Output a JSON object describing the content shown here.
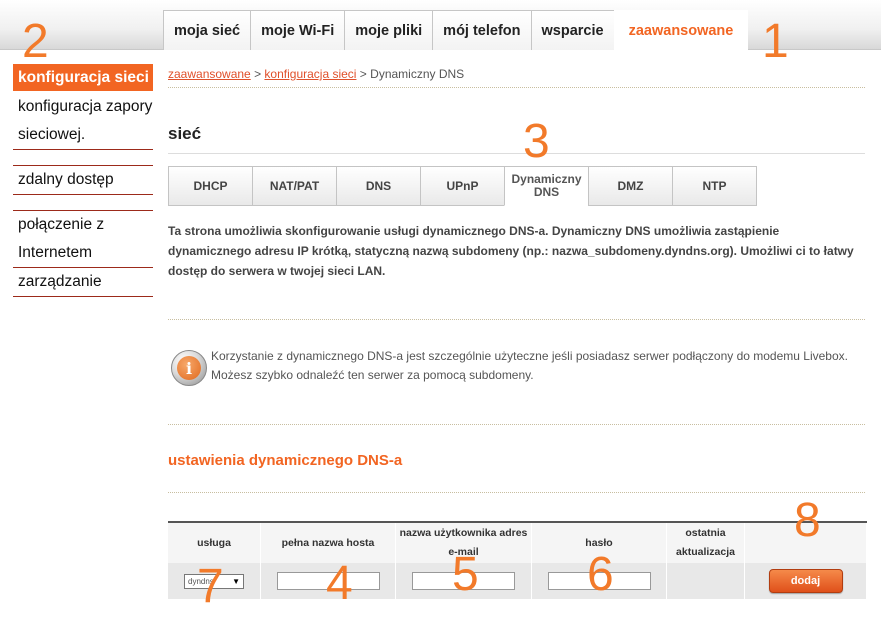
{
  "top_nav": {
    "tabs": [
      "moja sieć",
      "moje Wi-Fi",
      "moje pliki",
      "mój telefon",
      "wsparcie",
      "zaawansowane"
    ]
  },
  "sidebar": {
    "items": [
      "konfiguracja sieci",
      "konfiguracja zapory sieciowej.",
      "zdalny dostęp",
      "połączenie z Internetem",
      "zarządzanie"
    ]
  },
  "breadcrumb": {
    "link1": "zaawansowane",
    "sep1": " > ",
    "link2": "konfiguracja sieci",
    "sep2": " > ",
    "current": "Dynamiczny DNS"
  },
  "page_title": "sieć",
  "sub_tabs": [
    "DHCP",
    "NAT/PAT",
    "DNS",
    "UPnP",
    "Dynamiczny DNS",
    "DMZ",
    "NTP"
  ],
  "description": "Ta strona umożliwia skonfigurowanie usługi dynamicznego DNS-a. Dynamiczny DNS umożliwia zastąpienie dynamicznego adresu IP krótką, statyczną nazwą subdomeny (np.: nazwa_subdomeny.dyndns.org). Umożliwi ci to łatwy dostęp do serwera w twojej sieci LAN.",
  "info": {
    "icon": "info-icon",
    "text": "Korzystanie z dynamicznego DNS-a jest szczególnie użyteczne jeśli posiadasz serwer podłączony do modemu Livebox. Możesz szybko odnaleźć ten serwer za pomocą subdomeny."
  },
  "section_title": "ustawienia dynamicznego DNS-a",
  "table": {
    "headers": [
      "usługa",
      "pełna nazwa hosta",
      "nazwa użytkownika adres e-mail",
      "hasło",
      "ostatnia aktualizacja",
      ""
    ],
    "service_value": "dyndns",
    "hostname_value": "",
    "username_value": "",
    "password_value": "",
    "add_label": "dodaj"
  },
  "annotations": [
    "1",
    "2",
    "3",
    "4",
    "5",
    "6",
    "7",
    "8"
  ],
  "colors": {
    "accent": "#f26522",
    "annotation": "#f27a2a",
    "sidebar_line": "#9c2a1a"
  }
}
